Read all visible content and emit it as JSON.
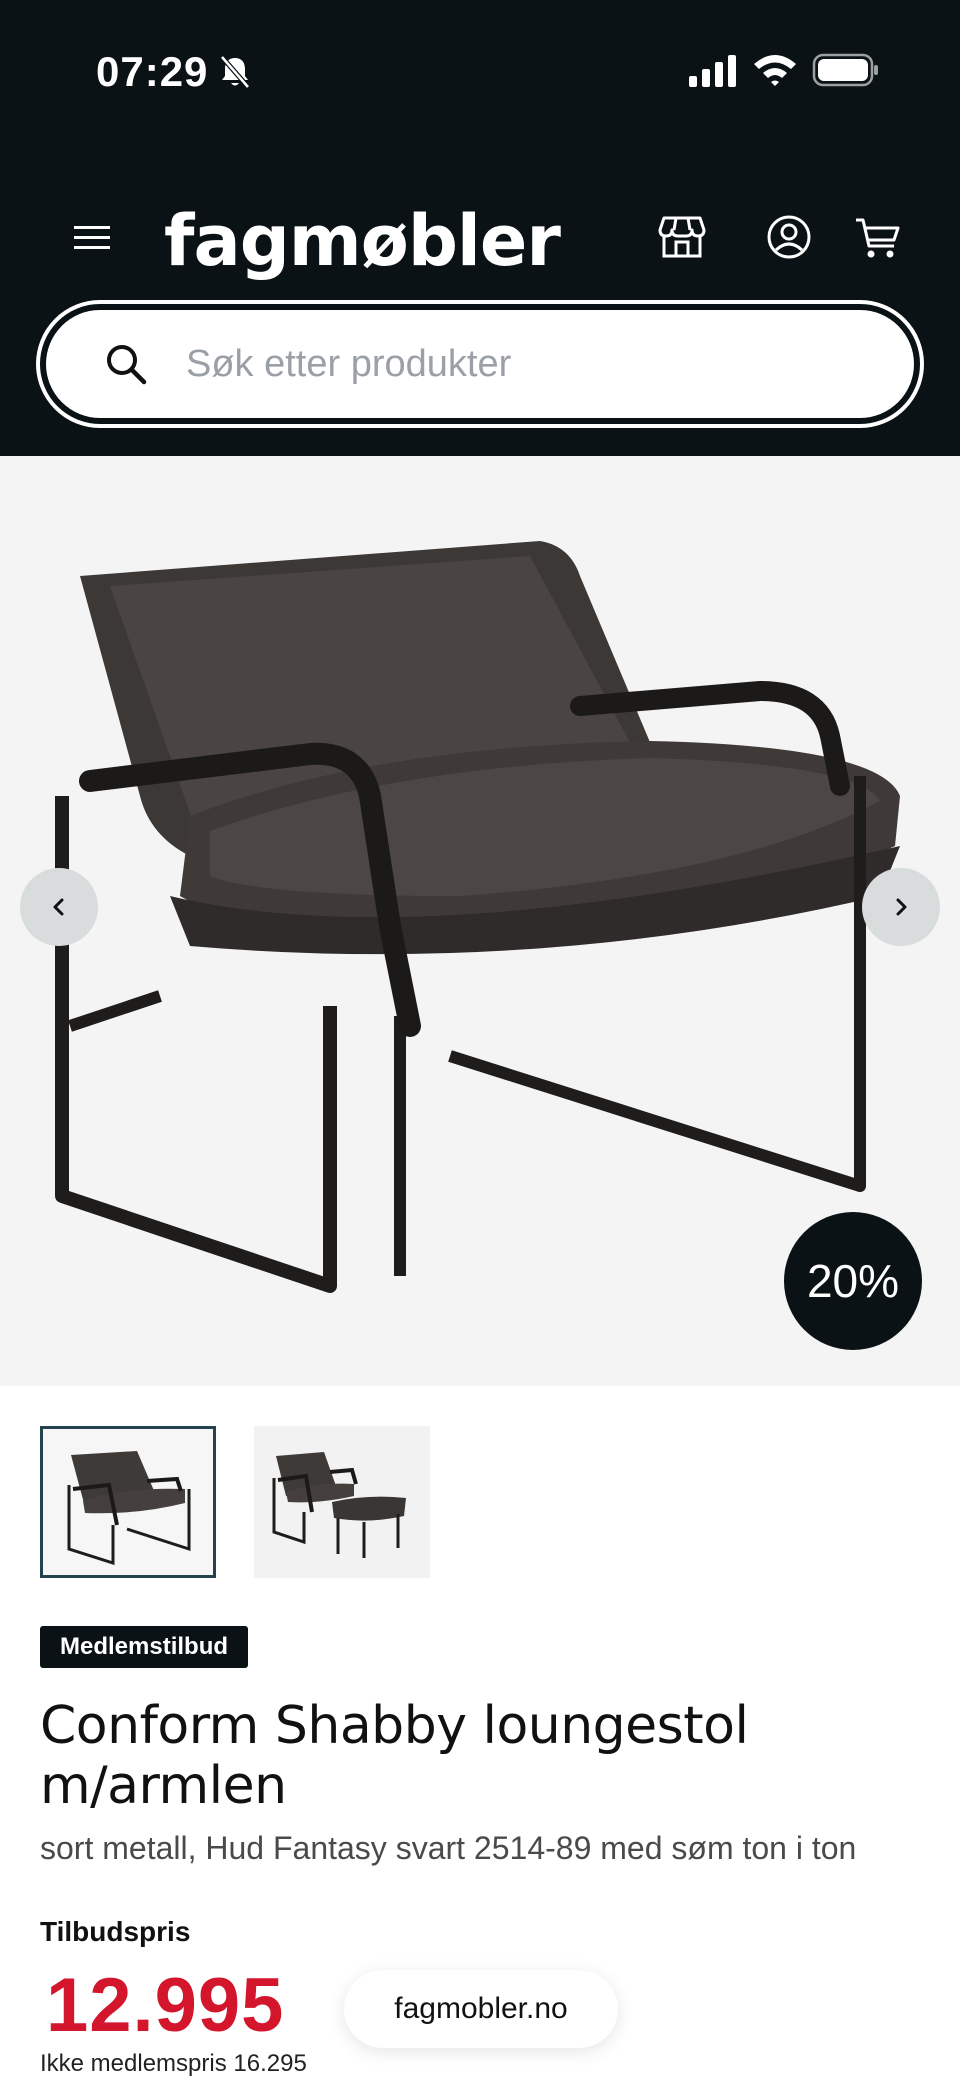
{
  "status_bar": {
    "time": "07:29"
  },
  "header": {
    "logo": "fagmøbler",
    "search_placeholder": "Søk etter produkter",
    "icons": [
      "menu-icon",
      "store-icon",
      "user-icon",
      "cart-icon"
    ]
  },
  "product": {
    "discount": "20%",
    "image_count": 2,
    "member_badge": "Medlemstilbud",
    "title_line1": "Conform Shabby loungestol",
    "title_line2": "m/armlen",
    "subtitle": "sort metall, Hud Fantasy svart 2514-89 med søm ton i ton",
    "price_label": "Tilbudspris",
    "price": "12.995",
    "regular_price": "Ikke medlemspris 16.295"
  },
  "browser": {
    "url": "fagmobler.no"
  },
  "colors": {
    "header_bg": "#0b1215",
    "price_red": "#d3162b",
    "hero_bg": "#f4f4f4",
    "thumb_border": "#23444f"
  }
}
